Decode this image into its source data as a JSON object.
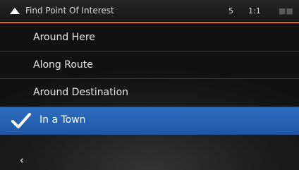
{
  "header": {
    "title": "Find Point Of Interest",
    "status_a": "5",
    "status_b": "1:1",
    "status_c": "■■",
    "up_icon": "triangle-up-icon",
    "accent_color": "#e0661b"
  },
  "options": [
    {
      "label": "Around Here",
      "selected": false
    },
    {
      "label": "Along Route",
      "selected": false
    },
    {
      "label": "Around Destination",
      "selected": false
    },
    {
      "label": "In a Town",
      "selected": true,
      "icon": "checkmark-icon",
      "highlight_color": "#2a67b8"
    }
  ],
  "footer": {
    "back_icon": "chevron-left-icon",
    "back_glyph": "‹"
  }
}
